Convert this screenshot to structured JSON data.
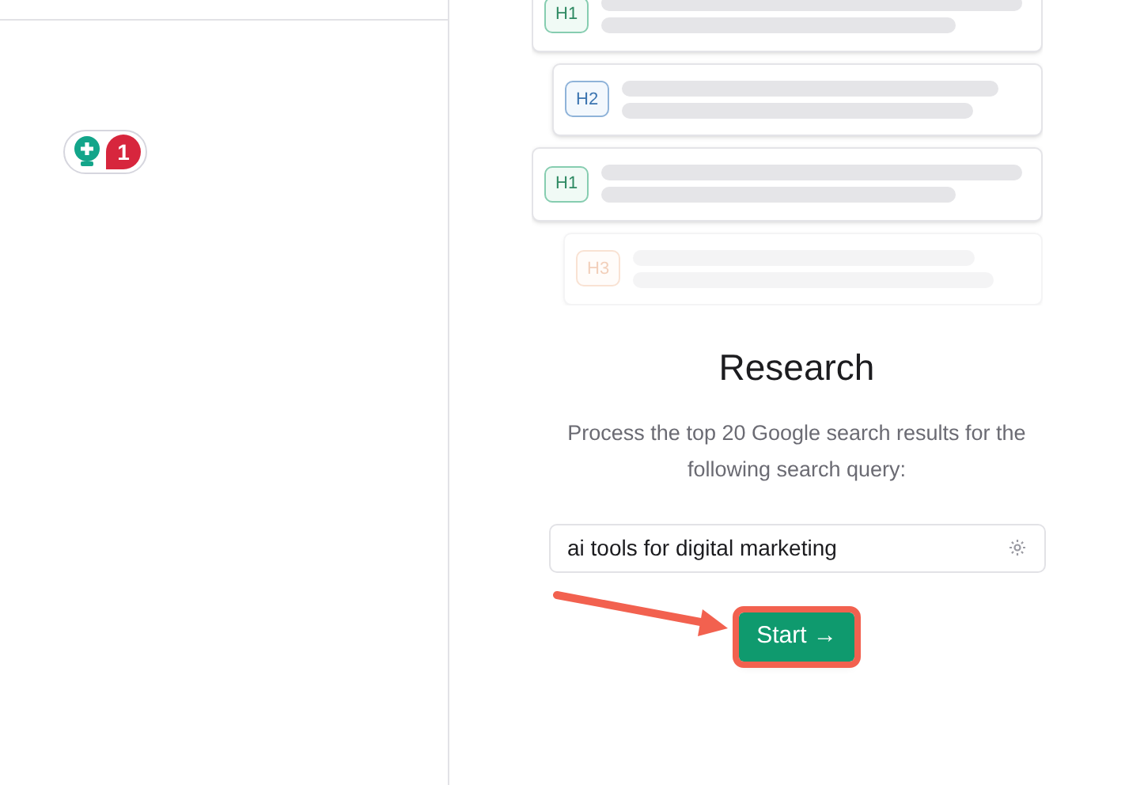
{
  "badge": {
    "count": "1"
  },
  "outline": [
    {
      "kind": "h1",
      "label": "H1"
    },
    {
      "kind": "h2",
      "label": "H2"
    },
    {
      "kind": "h1",
      "label": "H1"
    },
    {
      "kind": "h3",
      "label": "H3"
    }
  ],
  "title": "Research",
  "description": "Process the top 20 Google search results for the following search query:",
  "query": {
    "value": "ai tools for digital marketing"
  },
  "start_button": {
    "label": "Start →"
  }
}
